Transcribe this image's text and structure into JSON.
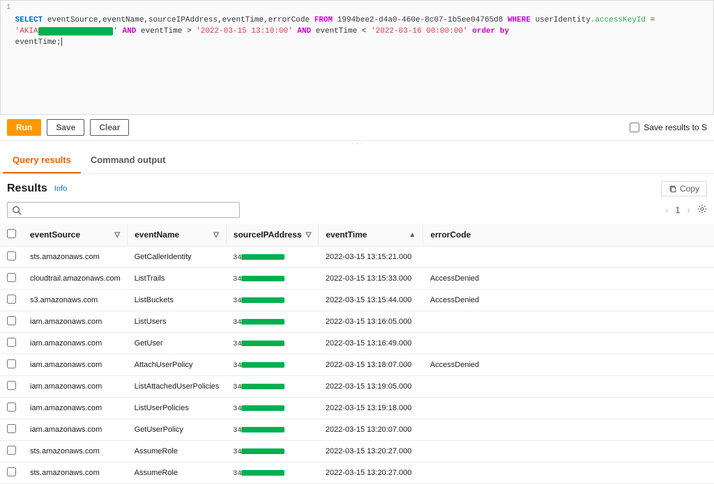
{
  "query": {
    "line_number": "1",
    "select_kw": "SELECT",
    "columns": "eventSource,eventName,sourceIPAddress,eventTime,errorCode",
    "from_kw": "FROM",
    "table_prefix": "1994",
    "table_rest": "bee2-d4a0-460e-8c07-1b5ee04765d8",
    "where_kw": "WHERE",
    "user_identity": "userIdentity",
    "access_key_field": ".accessKeyId",
    "eq": " = ",
    "akia_literal_quote": "'",
    "akia_prefix": "AKIA",
    "akia_redacted": "XXXXXXXXXXXXXXXX",
    "and_kw": "AND",
    "event_time_field": "eventTime",
    "gt": " > ",
    "lt": " < ",
    "ts1": "'2022-03-15 13:10:00'",
    "ts2": "'2022-03-16 00:00:00'",
    "orderby_kw": "order by",
    "second_line": "eventTime;"
  },
  "buttons": {
    "run": "Run",
    "save": "Save",
    "clear": "Clear",
    "save_results": "Save results to S",
    "copy": "Copy"
  },
  "tabs": {
    "query_results": "Query results",
    "command_output": "Command output"
  },
  "results_section": {
    "title": "Results",
    "info": "Info",
    "page": "1"
  },
  "columns": {
    "eventSource": "eventSource",
    "eventName": "eventName",
    "sourceIPAddress": "sourceIPAddress",
    "eventTime": "eventTime",
    "errorCode": "errorCode"
  },
  "rows": [
    {
      "eventSource": "sts.amazonaws.com",
      "eventName": "GetCallerIdentity",
      "ipPrefix": "34",
      "eventTime": "2022-03-15 13:15:21.000",
      "errorCode": ""
    },
    {
      "eventSource": "cloudtrail.amazonaws.com",
      "eventName": "ListTrails",
      "ipPrefix": "34",
      "eventTime": "2022-03-15 13:15:33.000",
      "errorCode": "AccessDenied"
    },
    {
      "eventSource": "s3.amazonaws.com",
      "eventName": "ListBuckets",
      "ipPrefix": "34",
      "eventTime": "2022-03-15 13:15:44.000",
      "errorCode": "AccessDenied"
    },
    {
      "eventSource": "iam.amazonaws.com",
      "eventName": "ListUsers",
      "ipPrefix": "34",
      "eventTime": "2022-03-15 13:16:05.000",
      "errorCode": ""
    },
    {
      "eventSource": "iam.amazonaws.com",
      "eventName": "GetUser",
      "ipPrefix": "34",
      "eventTime": "2022-03-15 13:16:49.000",
      "errorCode": ""
    },
    {
      "eventSource": "iam.amazonaws.com",
      "eventName": "AttachUserPolicy",
      "ipPrefix": "34",
      "eventTime": "2022-03-15 13:18:07.000",
      "errorCode": "AccessDenied"
    },
    {
      "eventSource": "iam.amazonaws.com",
      "eventName": "ListAttachedUserPolicies",
      "ipPrefix": "34",
      "eventTime": "2022-03-15 13:19:05.000",
      "errorCode": ""
    },
    {
      "eventSource": "iam.amazonaws.com",
      "eventName": "ListUserPolicies",
      "ipPrefix": "34",
      "eventTime": "2022-03-15 13:19:18.000",
      "errorCode": ""
    },
    {
      "eventSource": "iam.amazonaws.com",
      "eventName": "GetUserPolicy",
      "ipPrefix": "34",
      "eventTime": "2022-03-15 13:20:07.000",
      "errorCode": ""
    },
    {
      "eventSource": "sts.amazonaws.com",
      "eventName": "AssumeRole",
      "ipPrefix": "34",
      "eventTime": "2022-03-15 13:20:27.000",
      "errorCode": ""
    },
    {
      "eventSource": "sts.amazonaws.com",
      "eventName": "AssumeRole",
      "ipPrefix": "34",
      "eventTime": "2022-03-15 13:20:27.000",
      "errorCode": ""
    }
  ]
}
